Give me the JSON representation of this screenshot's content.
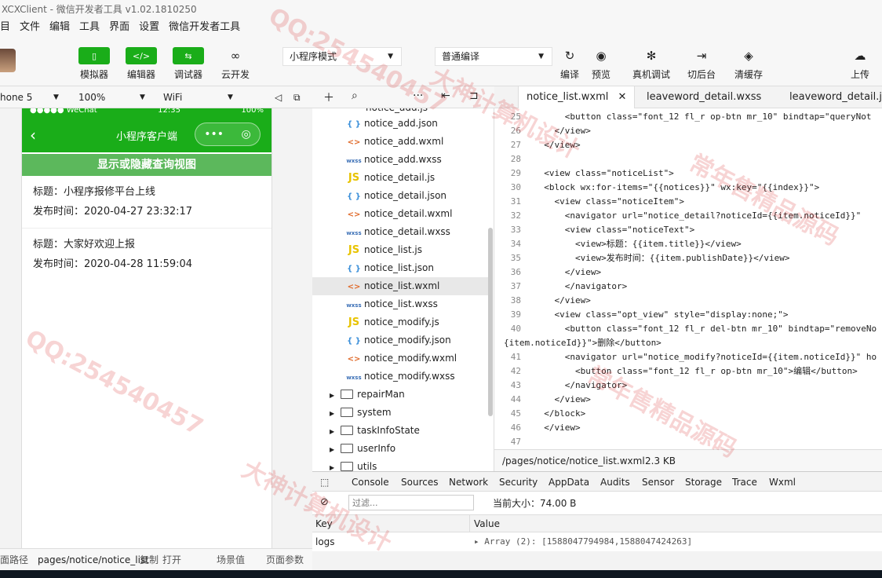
{
  "window": {
    "title": "XCXClient - 微信开发者工具 v1.02.1810250"
  },
  "menu": [
    "目",
    "文件",
    "编辑",
    "工具",
    "界面",
    "设置",
    "微信开发者工具"
  ],
  "toolbar": {
    "simulator": "模拟器",
    "editor": "编辑器",
    "debugger": "调试器",
    "cloud": "云开发",
    "mode_select": "小程序模式",
    "compile_select": "普通编译",
    "compile": "编译",
    "preview": "预览",
    "remote_debug": "真机调试",
    "background": "切后台",
    "clear_cache": "清缓存",
    "upload": "上传"
  },
  "device": {
    "model": "hone 5",
    "zoom": "100%",
    "network": "WiFi"
  },
  "phone": {
    "status_left": "●●●●● WeChat",
    "status_time": "12:35",
    "status_right": "100%",
    "nav_title": "小程序客户端",
    "toggle_label": "显示或隐藏查询视图",
    "notices": [
      {
        "title": "标题：小程序报修平台上线",
        "date": "发布时间：2020-04-27 23:32:17"
      },
      {
        "title": "标题：大家好欢迎上报",
        "date": "发布时间：2020-04-28 11:59:04"
      }
    ]
  },
  "bottom": {
    "path_label": "面路径",
    "path": "pages/notice/notice_list",
    "copy": "复制",
    "open": "打开",
    "scene": "场景值",
    "params": "页面参数"
  },
  "tree": {
    "top_partial": "notice_add.js",
    "files": [
      {
        "type": "json",
        "name": "notice_add.json"
      },
      {
        "type": "wxml",
        "name": "notice_add.wxml"
      },
      {
        "type": "wxss",
        "name": "notice_add.wxss"
      },
      {
        "type": "js",
        "name": "notice_detail.js"
      },
      {
        "type": "json",
        "name": "notice_detail.json"
      },
      {
        "type": "wxml",
        "name": "notice_detail.wxml"
      },
      {
        "type": "wxss",
        "name": "notice_detail.wxss"
      },
      {
        "type": "js",
        "name": "notice_list.js"
      },
      {
        "type": "json",
        "name": "notice_list.json"
      },
      {
        "type": "wxml",
        "name": "notice_list.wxml",
        "active": true
      },
      {
        "type": "wxss",
        "name": "notice_list.wxss"
      },
      {
        "type": "js",
        "name": "notice_modify.js"
      },
      {
        "type": "json",
        "name": "notice_modify.json"
      },
      {
        "type": "wxml",
        "name": "notice_modify.wxml"
      },
      {
        "type": "wxss",
        "name": "notice_modify.wxss"
      }
    ],
    "folders": [
      "repairMan",
      "system",
      "taskInfoState",
      "userInfo",
      "utils"
    ],
    "icon_labels": {
      "js": "JS",
      "json": "{ }",
      "wxml": "<>",
      "wxss": "wxss"
    }
  },
  "tabs": [
    "notice_list.wxml",
    "leaveword_detail.wxss",
    "leaveword_detail.json"
  ],
  "code": [
    {
      "n": "25",
      "t": "      <button class=\"font_12 fl_r op-btn mr_10\" bindtap=\"queryNot"
    },
    {
      "n": "26",
      "t": "    </view>"
    },
    {
      "n": "27",
      "t": "  </view>"
    },
    {
      "n": "28",
      "t": ""
    },
    {
      "n": "29",
      "t": "  <view class=\"noticeList\">"
    },
    {
      "n": "30",
      "t": "  <block wx:for-items=\"{{notices}}\" wx:key=\"{{index}}\">"
    },
    {
      "n": "31",
      "t": "    <view class=\"noticeItem\">"
    },
    {
      "n": "32",
      "t": "      <navigator url=\"notice_detail?noticeId={{item.noticeId}}\""
    },
    {
      "n": "33",
      "t": "      <view class=\"noticeText\">"
    },
    {
      "n": "34",
      "t": "        <view>标题：{{item.title}}</view>"
    },
    {
      "n": "35",
      "t": "        <view>发布时间：{{item.publishDate}}</view>"
    },
    {
      "n": "36",
      "t": "      </view>"
    },
    {
      "n": "37",
      "t": "      </navigator>"
    },
    {
      "n": "38",
      "t": "    </view>"
    },
    {
      "n": "39",
      "t": "    <view class=\"opt_view\" style=\"display:none;\">"
    },
    {
      "n": "40",
      "t": "      <button class=\"font_12 fl_r del-btn mr_10\" bindtap=\"removeNo"
    },
    {
      "n": "",
      "t": "{item.noticeId}}\">删除</button>"
    },
    {
      "n": "41",
      "t": "      <navigator url=\"notice_modify?noticeId={{item.noticeId}}\" ho"
    },
    {
      "n": "42",
      "t": "        <button class=\"font_12 fl_r op-btn mr_10\">编辑</button>"
    },
    {
      "n": "43",
      "t": "      </navigator>"
    },
    {
      "n": "44",
      "t": "    </view>"
    },
    {
      "n": "45",
      "t": "  </block>"
    },
    {
      "n": "46",
      "t": "  </view>"
    },
    {
      "n": "47",
      "t": ""
    }
  ],
  "fileinfo": {
    "path": "/pages/notice/notice_list.wxml",
    "size": "2.3 KB"
  },
  "devtools": {
    "tabs": [
      "Console",
      "Sources",
      "Network",
      "Security",
      "AppData",
      "Audits",
      "Sensor",
      "Storage",
      "Trace",
      "Wxml"
    ],
    "active": "Storage",
    "filter_placeholder": "过滤...",
    "size_label": "当前大小：74.00 B",
    "col_key": "Key",
    "col_value": "Value",
    "row_key": "logs",
    "row_value": "▸ Array (2): [1588047794984,1588047424263]"
  },
  "watermarks": [
    "QQ:254540457",
    "大神计算机设计",
    "常年售精品源码"
  ],
  "colors": {
    "wechat_green": "#1aad19",
    "button_green": "#5cb85c"
  }
}
